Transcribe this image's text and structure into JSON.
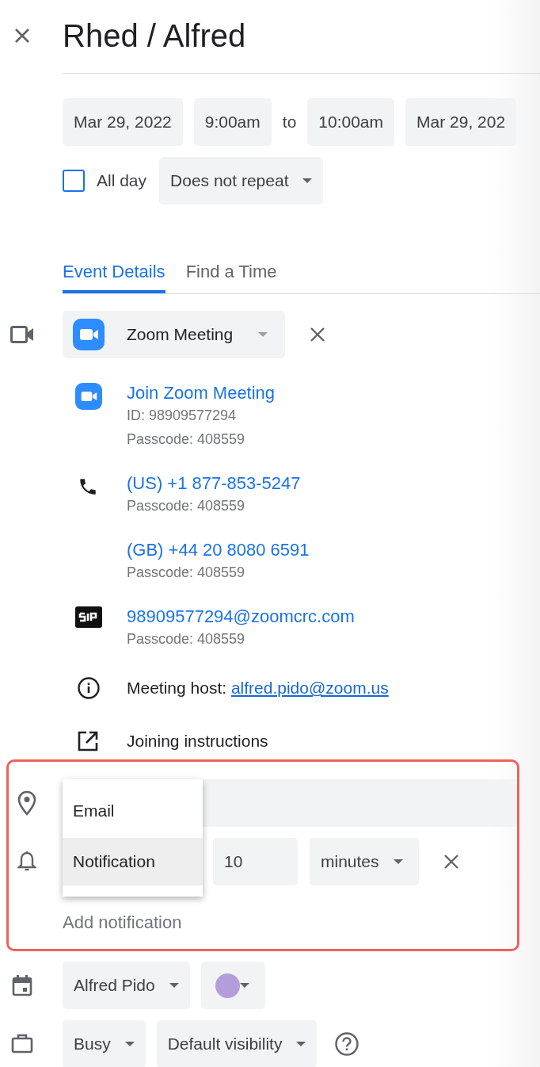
{
  "title": "Rhed / Alfred",
  "dates": {
    "start_date": "Mar 29, 2022",
    "start_time": "9:00am",
    "separator": "to",
    "end_time": "10:00am",
    "end_date": "Mar 29, 202"
  },
  "all_day": {
    "label": "All day",
    "checked": false
  },
  "repeat": "Does not repeat",
  "tabs": [
    {
      "label": "Event Details",
      "selected": true
    },
    {
      "label": "Find a Time",
      "selected": false
    }
  ],
  "conference": {
    "provider": "Zoom Meeting"
  },
  "join_options": [
    {
      "kind": "video",
      "link": "Join Zoom Meeting",
      "lines": [
        "ID: 98909577294",
        "Passcode: 408559"
      ]
    },
    {
      "kind": "phone",
      "link": "(US) +1 877-853-5247",
      "lines": [
        "Passcode: 408559"
      ]
    },
    {
      "kind": "none",
      "link": "(GB) +44 20 8080 6591",
      "lines": [
        "Passcode: 408559"
      ]
    },
    {
      "kind": "sip",
      "link": "98909577294@zoomcrc.com",
      "lines": [
        "Passcode: 408559"
      ]
    }
  ],
  "host": {
    "label": "Meeting host:",
    "email": "alfred.pido@zoom.us"
  },
  "joining_instructions": "Joining instructions",
  "notification_menu": [
    {
      "label": "Email",
      "selected": false
    },
    {
      "label": "Notification",
      "selected": true
    }
  ],
  "notification": {
    "value": "10",
    "unit": "minutes"
  },
  "add_notification": "Add notification",
  "calendar": {
    "owner": "Alfred Pido",
    "color": "#b39ddb"
  },
  "availability": "Busy",
  "visibility": "Default visibility"
}
